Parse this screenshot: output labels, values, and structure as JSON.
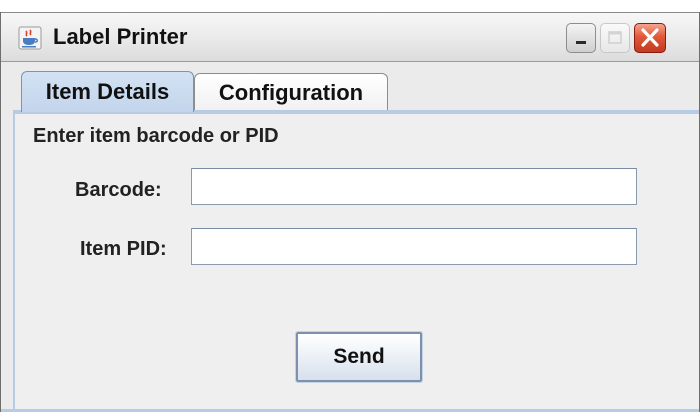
{
  "window": {
    "title": "Label Printer",
    "app_icon": "java-coffee-icon",
    "controls": {
      "minimize_icon": "minimize-icon",
      "maximize_icon": "maximize-icon",
      "close_icon": "close-icon"
    }
  },
  "tabs": [
    {
      "label": "Item Details",
      "active": true
    },
    {
      "label": "Configuration",
      "active": false
    }
  ],
  "form": {
    "instruction": "Enter item barcode or PID",
    "barcode": {
      "label": "Barcode:",
      "value": "",
      "placeholder": ""
    },
    "item_pid": {
      "label": "Item PID:",
      "value": "",
      "placeholder": ""
    },
    "send_label": "Send"
  },
  "colors": {
    "accent": "#b7cbe6",
    "close_button": "#e1583a",
    "panel_background": "#efefef"
  }
}
